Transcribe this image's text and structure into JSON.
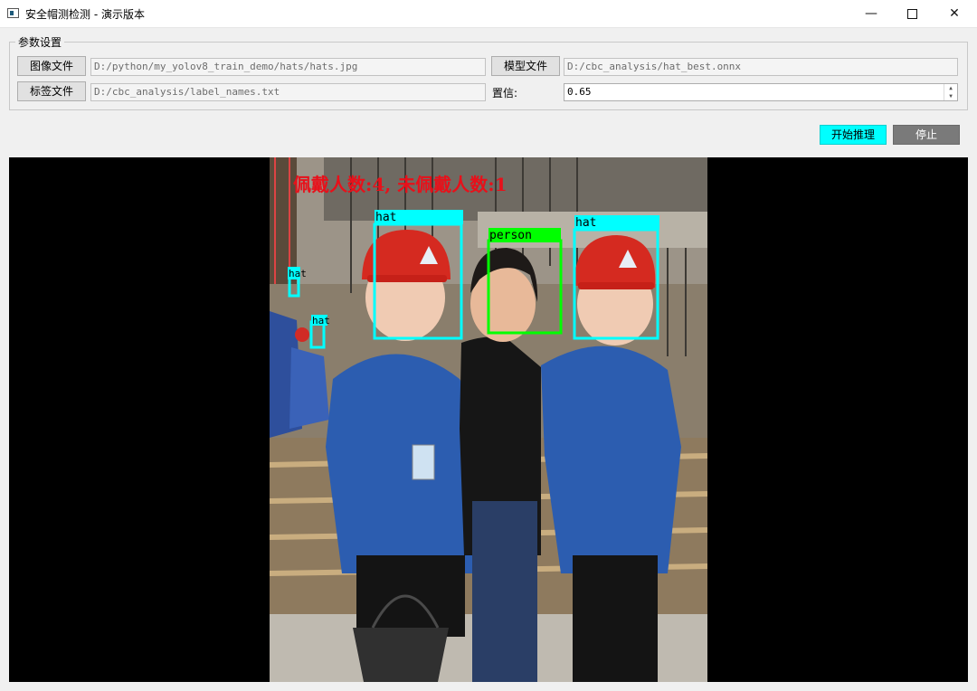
{
  "window": {
    "title": "安全帽测检测 - 演示版本",
    "minimize_glyph": "—",
    "close_glyph": "✕"
  },
  "params": {
    "group_title": "参数设置",
    "image_button": "图像文件",
    "image_path": "D:/python/my_yolov8_train_demo/hats/hats.jpg",
    "model_button": "模型文件",
    "model_path": "D:/cbc_analysis/hat_best.onnx",
    "label_button": "标签文件",
    "label_path": "D:/cbc_analysis/label_names.txt",
    "confidence_label": "置信:",
    "confidence_value": "0.65"
  },
  "actions": {
    "start_label": "开始推理",
    "stop_label": "停止",
    "start_color": "#00ffff",
    "stop_color": "#7a7a7a"
  },
  "result": {
    "status_text": "佩戴人数:4, 未佩戴人数:1",
    "status_color": "#e8101a",
    "detections": [
      {
        "label": "hat",
        "color": "#00ffff"
      },
      {
        "label": "person",
        "color": "#00ff00"
      },
      {
        "label": "hat",
        "color": "#00ffff"
      },
      {
        "label": "hat",
        "color": "#00ffff"
      },
      {
        "label": "hat",
        "color": "#00ffff"
      }
    ]
  }
}
